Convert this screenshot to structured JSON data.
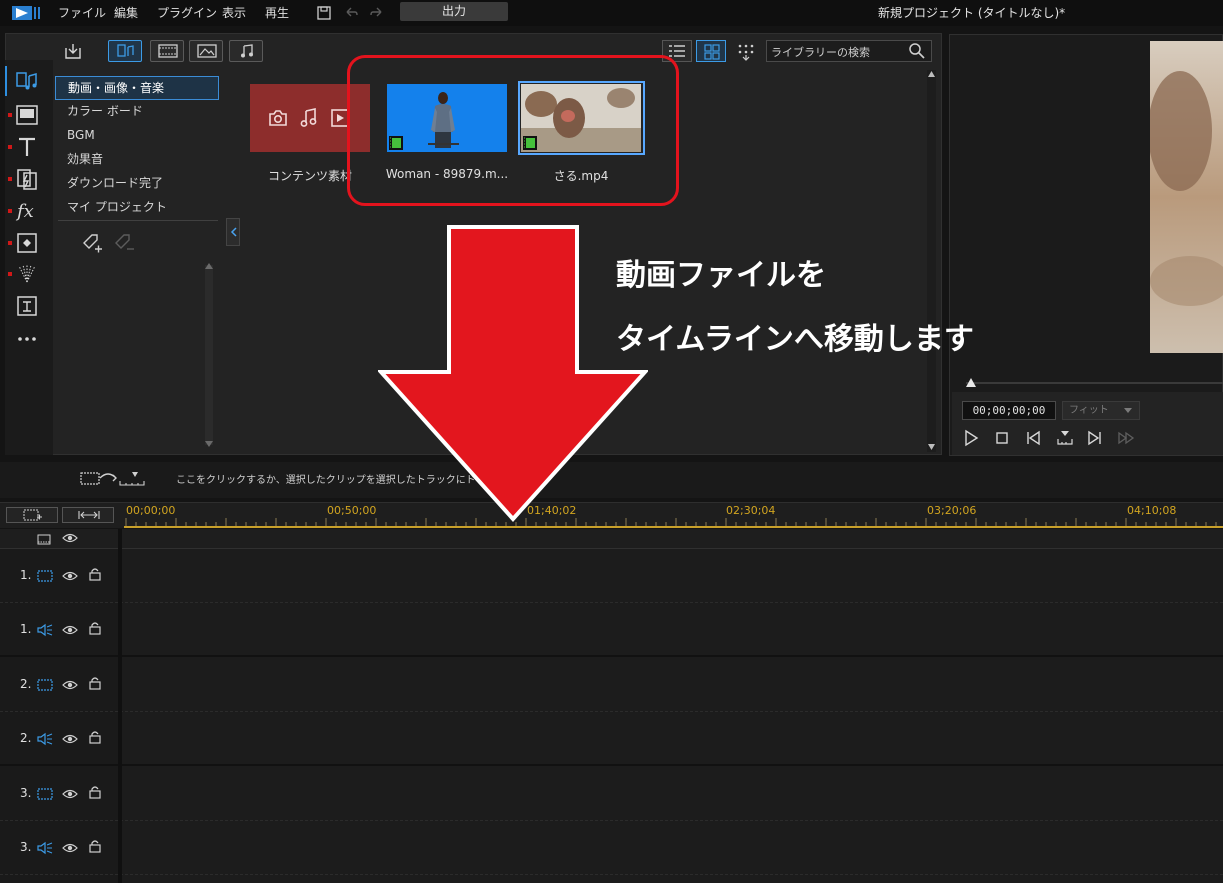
{
  "menu": {
    "items": [
      "ファイル",
      "編集",
      "プラグイン",
      "表示",
      "再生"
    ],
    "output_label": "出力",
    "project_title": "新規プロジェクト (タイトルなし)*"
  },
  "library": {
    "search_placeholder": "ライブラリーの検索",
    "categories": [
      "動画・画像・音楽",
      "カラー ボード",
      "BGM",
      "効果音",
      "ダウンロード完了",
      "マイ プロジェクト"
    ],
    "media": [
      {
        "label": "コンテンツ素材"
      },
      {
        "label": "Woman - 89879.m..."
      },
      {
        "label": "さる.mp4"
      }
    ]
  },
  "annotation": {
    "line1": "動画ファイルを",
    "line2": "タイムラインへ移動します"
  },
  "preview": {
    "timecode": "00;00;00;00",
    "fit_label": "フィット"
  },
  "timeline": {
    "hint": "ここをクリックするか、選択したクリップを選択したトラックにドラッグし",
    "ruler_labels": [
      "00;00;00",
      "00;50;00",
      "01;40;02",
      "02;30;04",
      "03;20;06",
      "04;10;08"
    ],
    "tracks": [
      {
        "num": "1.",
        "type": "video"
      },
      {
        "num": "1.",
        "type": "audio"
      },
      {
        "num": "2.",
        "type": "video"
      },
      {
        "num": "2.",
        "type": "audio"
      },
      {
        "num": "3.",
        "type": "video"
      },
      {
        "num": "3.",
        "type": "audio"
      }
    ]
  },
  "colors": {
    "accent": "#3c9be6",
    "annotation_red": "#e3131d",
    "ruler_gold": "#c8a02a"
  }
}
